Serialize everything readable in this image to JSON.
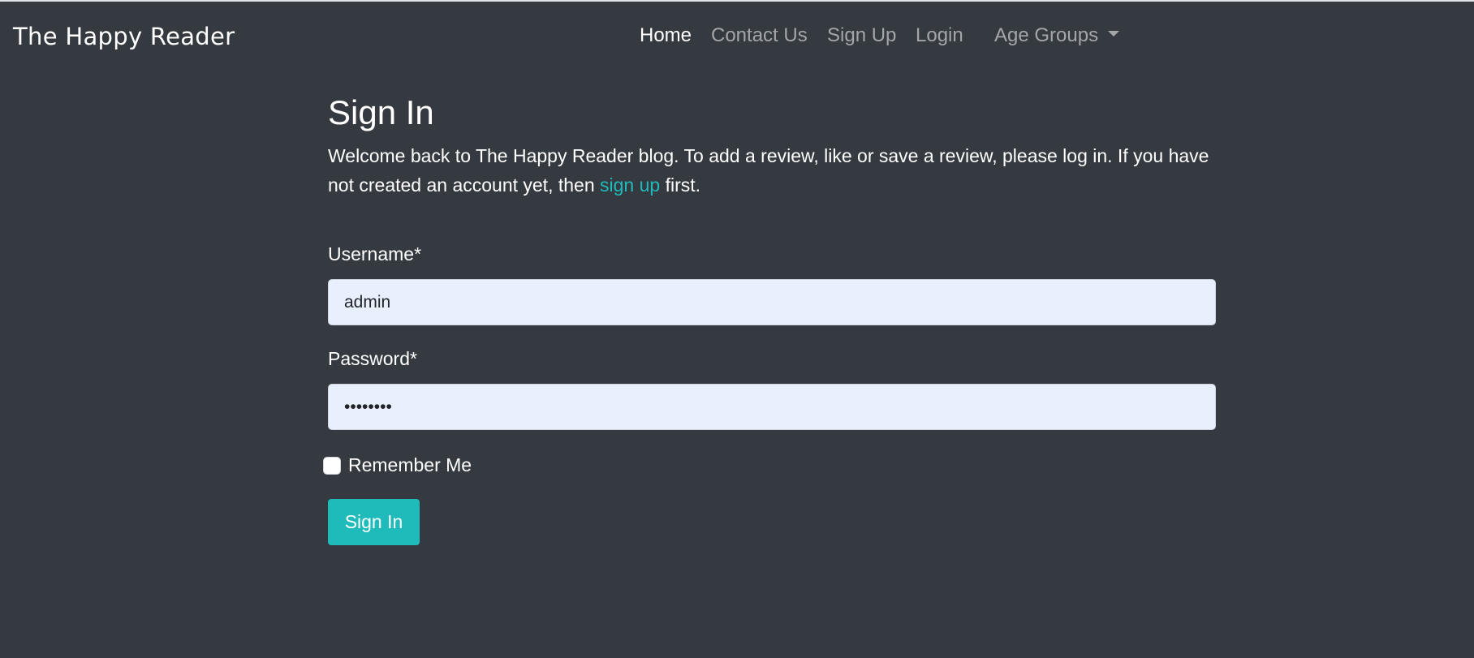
{
  "navbar": {
    "brand": "The Happy Reader",
    "links": [
      {
        "label": "Home",
        "active": true
      },
      {
        "label": "Contact Us",
        "active": false
      },
      {
        "label": "Sign Up",
        "active": false
      },
      {
        "label": "Login",
        "active": false
      }
    ],
    "dropdown": {
      "label": "Age Groups"
    }
  },
  "page": {
    "title": "Sign In",
    "intro_before": "Welcome back to The Happy Reader blog. To add a review, like or save a review, please log in. If you have not created an account yet, then ",
    "intro_link": "sign up",
    "intro_after": " first."
  },
  "form": {
    "username_label": "Username*",
    "username_value": "admin",
    "password_label": "Password*",
    "password_value": "12345678",
    "remember_label": "Remember Me",
    "remember_checked": false,
    "submit_label": "Sign In"
  },
  "colors": {
    "background": "#343a40",
    "accent": "#1fbbbb",
    "input_bg": "#e8f0fe"
  }
}
